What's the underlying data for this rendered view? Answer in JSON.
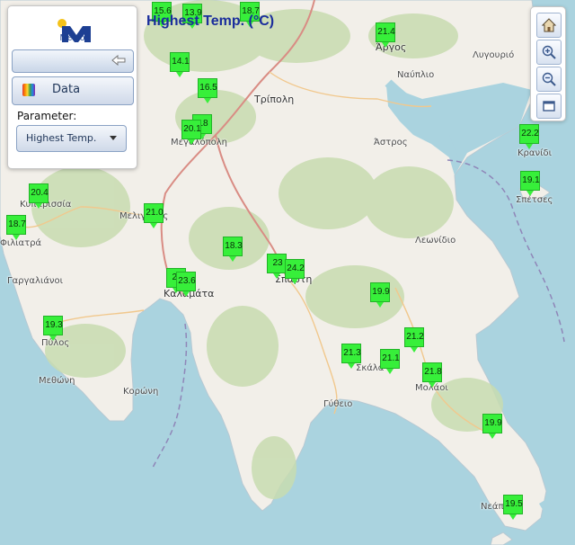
{
  "app": {
    "logo_text": "Meteo"
  },
  "panel": {
    "data_label": "Data",
    "parameter_label": "Parameter:",
    "parameter_value": "Highest Temp."
  },
  "map": {
    "title": "Highest Temp. (°C)",
    "places": [
      {
        "id": "argos",
        "name": "Άργος",
        "big": true
      },
      {
        "id": "lygourio",
        "name": "Λυγουριό"
      },
      {
        "id": "nafplio",
        "name": "Ναύπλιο"
      },
      {
        "id": "tripoli",
        "name": "Τρίπολη",
        "big": true
      },
      {
        "id": "megalopoli",
        "name": "Μεγαλόπολη"
      },
      {
        "id": "astros",
        "name": "Άστρος"
      },
      {
        "id": "kranidi",
        "name": "Κρανίδι"
      },
      {
        "id": "spetses",
        "name": "Σπέτσες"
      },
      {
        "id": "kyparissia",
        "name": "Κυπαρισσία"
      },
      {
        "id": "filiatra",
        "name": "Φιλιατρά"
      },
      {
        "id": "meligalas",
        "name": "Μελιγαλάς"
      },
      {
        "id": "leonidio",
        "name": "Λεωνίδιο"
      },
      {
        "id": "gargalianoi",
        "name": "Γαργαλιάνοι"
      },
      {
        "id": "kalamata",
        "name": "Καλαμάτα",
        "big": true
      },
      {
        "id": "sparti",
        "name": "Σπάρτη",
        "big": true
      },
      {
        "id": "pylos",
        "name": "Πύλος"
      },
      {
        "id": "methoni",
        "name": "Μεθώνη"
      },
      {
        "id": "koroni",
        "name": "Κορώνη"
      },
      {
        "id": "skala",
        "name": "Σκάλα"
      },
      {
        "id": "molaoi",
        "name": "Μολάοι"
      },
      {
        "id": "gytheio",
        "name": "Γύθειο"
      },
      {
        "id": "neapoli",
        "name": "Νεάπολη"
      }
    ],
    "stations": [
      {
        "id": "s1",
        "value": "15.6"
      },
      {
        "id": "s2",
        "value": "13.9"
      },
      {
        "id": "s3",
        "value": "18.7"
      },
      {
        "id": "s4",
        "value": "21.4"
      },
      {
        "id": "s5",
        "value": "14.1"
      },
      {
        "id": "s6",
        "value": "16.5"
      },
      {
        "id": "s7",
        "value": "18"
      },
      {
        "id": "s8",
        "value": "20.1"
      },
      {
        "id": "s9",
        "value": "22.2"
      },
      {
        "id": "s10",
        "value": "19.1"
      },
      {
        "id": "s11",
        "value": "20.4"
      },
      {
        "id": "s12",
        "value": "18.7"
      },
      {
        "id": "s13",
        "value": "21.0"
      },
      {
        "id": "s14",
        "value": "18.3"
      },
      {
        "id": "s15",
        "value": "23"
      },
      {
        "id": "s16",
        "value": "24.2"
      },
      {
        "id": "s17",
        "value": "23"
      },
      {
        "id": "s18",
        "value": "23.6"
      },
      {
        "id": "s19",
        "value": "19.9"
      },
      {
        "id": "s20",
        "value": "19.3"
      },
      {
        "id": "s21",
        "value": "21.2"
      },
      {
        "id": "s22",
        "value": "21.3"
      },
      {
        "id": "s23",
        "value": "21.1"
      },
      {
        "id": "s24",
        "value": "21.8"
      },
      {
        "id": "s25",
        "value": "19.9"
      },
      {
        "id": "s26",
        "value": "19.5"
      }
    ]
  },
  "toolbar": {
    "icons": [
      "home-icon",
      "zoom-in-icon",
      "zoom-out-icon",
      "fullscreen-icon"
    ]
  },
  "colors": {
    "sea": "#aad3df",
    "land": "#f2efe9",
    "forest": "#c8dcb0",
    "station_fill": "#37ef3a",
    "title": "#1a2d9c"
  }
}
